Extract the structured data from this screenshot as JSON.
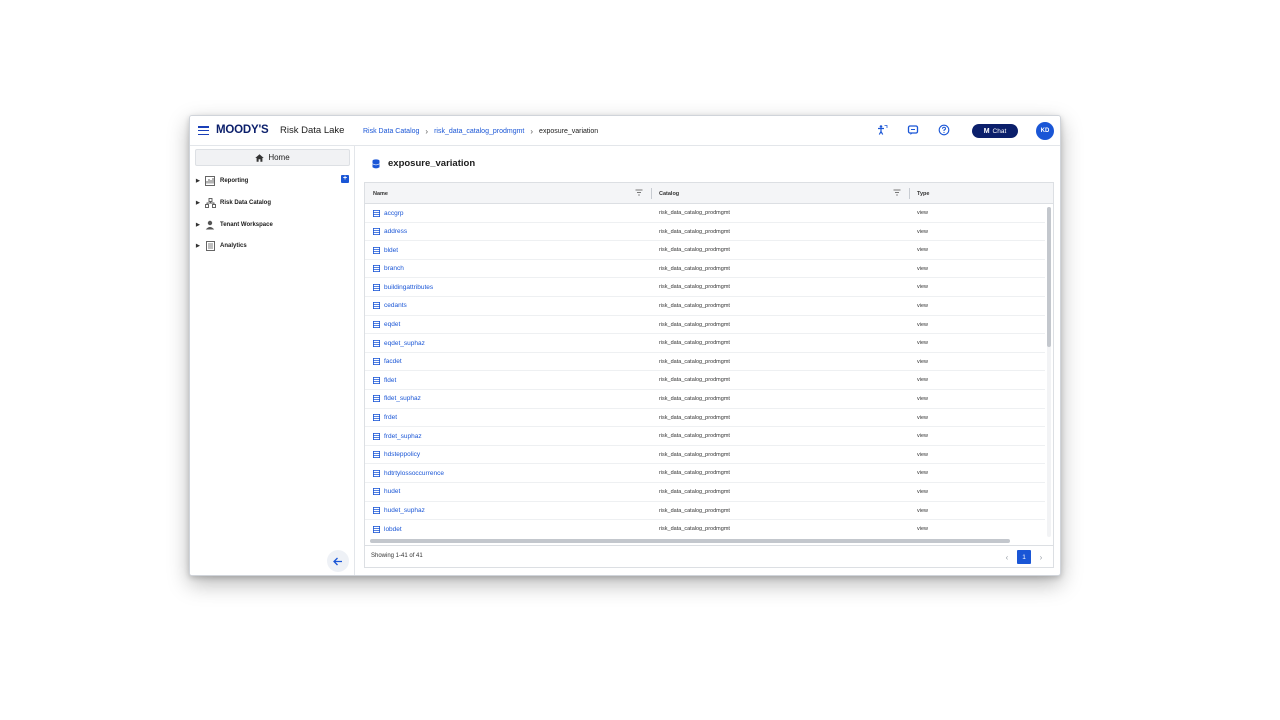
{
  "header": {
    "logo": "MOODY'S",
    "app_name": "Risk Data Lake",
    "breadcrumb": [
      "Risk Data Catalog",
      "risk_data_catalog_prodmgmt",
      "exposure_variation"
    ],
    "chat_label": "Chat",
    "chat_mark": "M",
    "avatar_initials": "KD",
    "icons": [
      "hamburger-icon",
      "accessibility-icon",
      "message-icon",
      "help-icon"
    ]
  },
  "sidebar": {
    "home_label": "Home",
    "items": [
      {
        "label": "Reporting",
        "icon": "reporting-icon"
      },
      {
        "label": "Risk Data Catalog",
        "icon": "catalog-icon"
      },
      {
        "label": "Tenant Workspace",
        "icon": "person-icon"
      },
      {
        "label": "Analytics",
        "icon": "analytics-icon"
      }
    ]
  },
  "main": {
    "title": "exposure_variation",
    "columns": [
      "Name",
      "Catalog",
      "Type"
    ],
    "rows": [
      {
        "name": "accgrp",
        "catalog": "risk_data_catalog_prodmgmt",
        "type": "view"
      },
      {
        "name": "address",
        "catalog": "risk_data_catalog_prodmgmt",
        "type": "view"
      },
      {
        "name": "bldet",
        "catalog": "risk_data_catalog_prodmgmt",
        "type": "view"
      },
      {
        "name": "branch",
        "catalog": "risk_data_catalog_prodmgmt",
        "type": "view"
      },
      {
        "name": "buildingattributes",
        "catalog": "risk_data_catalog_prodmgmt",
        "type": "view"
      },
      {
        "name": "cedants",
        "catalog": "risk_data_catalog_prodmgmt",
        "type": "view"
      },
      {
        "name": "eqdet",
        "catalog": "risk_data_catalog_prodmgmt",
        "type": "view"
      },
      {
        "name": "eqdet_suphaz",
        "catalog": "risk_data_catalog_prodmgmt",
        "type": "view"
      },
      {
        "name": "facdet",
        "catalog": "risk_data_catalog_prodmgmt",
        "type": "view"
      },
      {
        "name": "fldet",
        "catalog": "risk_data_catalog_prodmgmt",
        "type": "view"
      },
      {
        "name": "fldet_suphaz",
        "catalog": "risk_data_catalog_prodmgmt",
        "type": "view"
      },
      {
        "name": "frdet",
        "catalog": "risk_data_catalog_prodmgmt",
        "type": "view"
      },
      {
        "name": "frdet_suphaz",
        "catalog": "risk_data_catalog_prodmgmt",
        "type": "view"
      },
      {
        "name": "hdsteppolicy",
        "catalog": "risk_data_catalog_prodmgmt",
        "type": "view"
      },
      {
        "name": "hdtrtylossoccurrence",
        "catalog": "risk_data_catalog_prodmgmt",
        "type": "view"
      },
      {
        "name": "hudet",
        "catalog": "risk_data_catalog_prodmgmt",
        "type": "view"
      },
      {
        "name": "hudet_suphaz",
        "catalog": "risk_data_catalog_prodmgmt",
        "type": "view"
      },
      {
        "name": "lobdet",
        "catalog": "risk_data_catalog_prodmgmt",
        "type": "view"
      }
    ],
    "showing": "Showing 1-41 of 41",
    "page": "1"
  },
  "colors": {
    "accent": "#1a56d6",
    "brand": "#0b1f6b"
  }
}
